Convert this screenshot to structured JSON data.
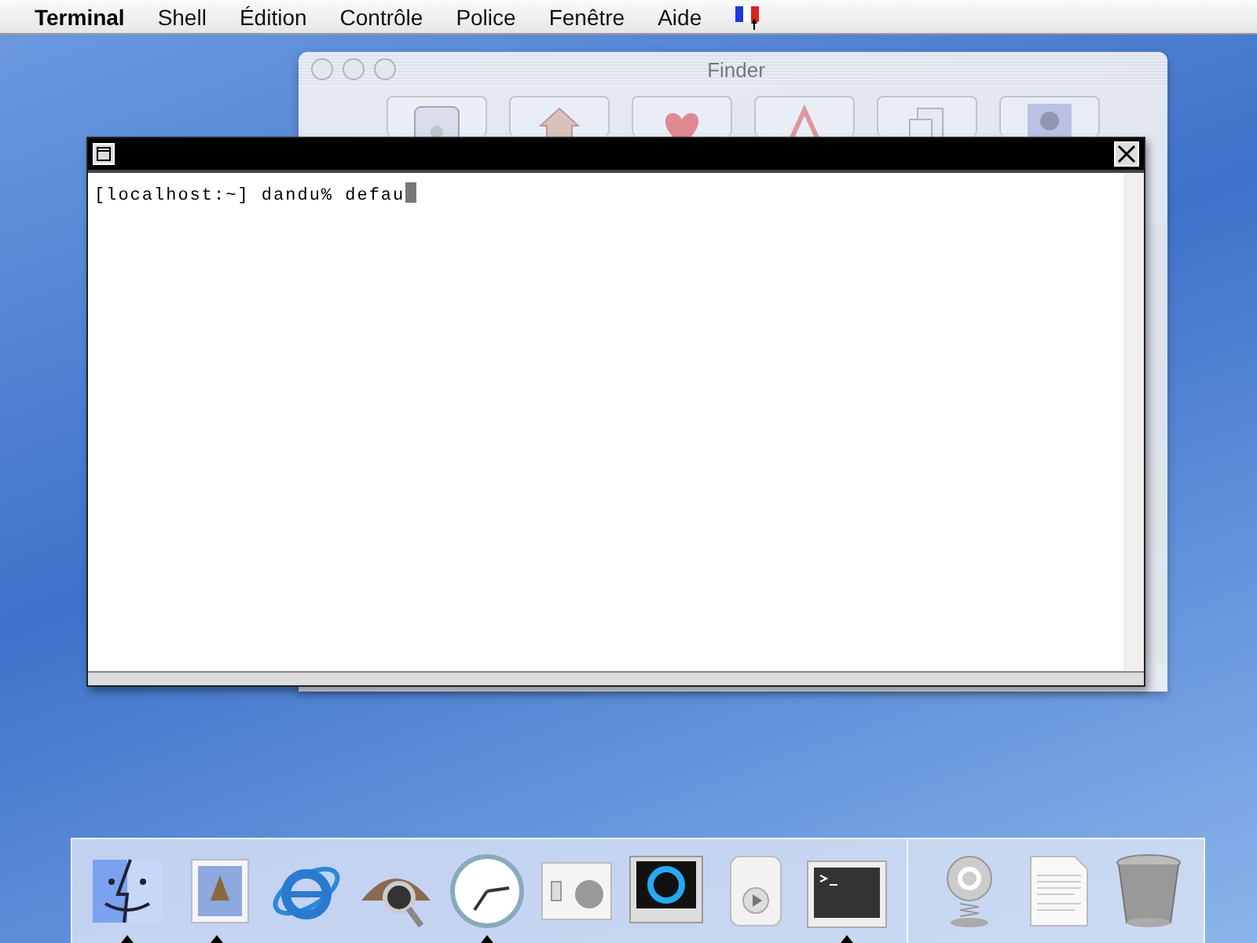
{
  "menu_bar": {
    "app_menu": "Terminal",
    "menus": [
      "Shell",
      "Édition",
      "Contrôle",
      "Police",
      "Fenêtre",
      "Aide"
    ]
  },
  "finder_window": {
    "title": "Finder",
    "toolbar": [
      {
        "kind": "computer"
      },
      {
        "kind": "home"
      },
      {
        "kind": "favorites"
      },
      {
        "kind": "applications"
      },
      {
        "kind": "documents"
      },
      {
        "kind": "user"
      }
    ]
  },
  "terminal_window": {
    "lines": [
      "[localhost:~] dandu% defau"
    ]
  },
  "dock": {
    "apps": [
      {
        "kind": "finder",
        "running": true
      },
      {
        "kind": "mail",
        "running": true
      },
      {
        "kind": "browser",
        "running": false
      },
      {
        "kind": "sherlock",
        "running": false
      },
      {
        "kind": "clock",
        "running": true
      },
      {
        "kind": "preferences",
        "running": false
      },
      {
        "kind": "quicktime",
        "running": false
      },
      {
        "kind": "itunes",
        "running": false
      },
      {
        "kind": "terminal",
        "running": true
      }
    ],
    "documents": [
      {
        "kind": "internet"
      },
      {
        "kind": "readme"
      },
      {
        "kind": "trash"
      }
    ]
  }
}
